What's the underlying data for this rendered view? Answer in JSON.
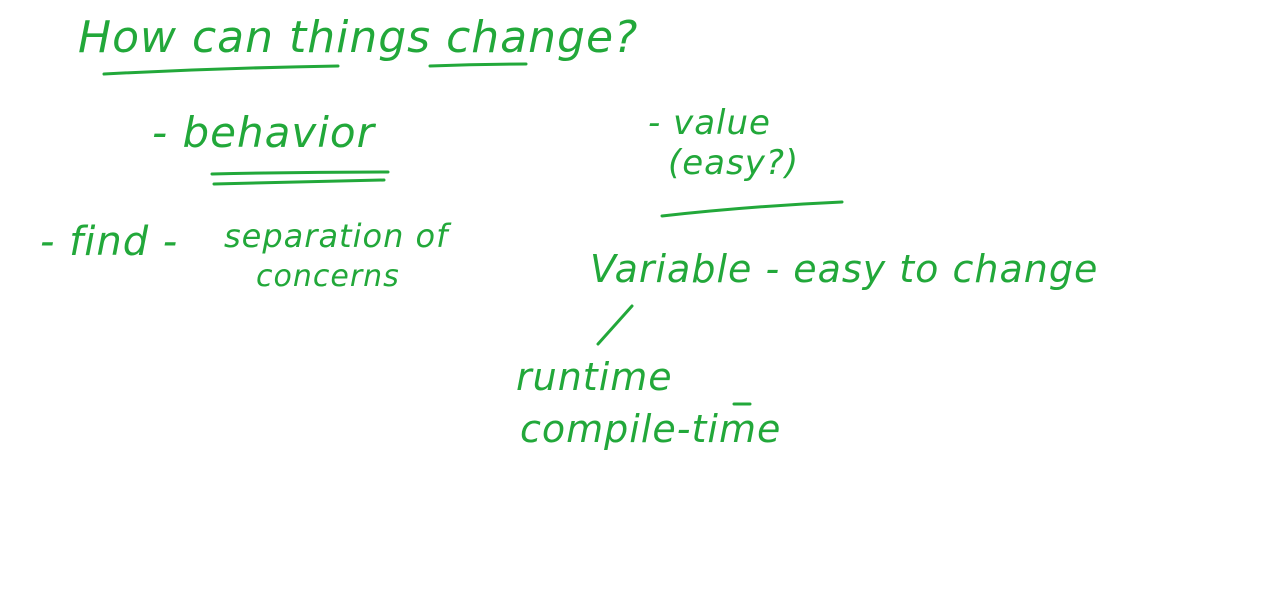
{
  "notes": {
    "title": "How can things change?",
    "behavior": "- behavior",
    "value": "- value",
    "value_note": "(easy?)",
    "find": "- find -",
    "separation": "separation of",
    "concerns": "concerns",
    "variable": "Variable - easy to change",
    "runtime": "runtime",
    "compile_time": "compile-time"
  },
  "colors": {
    "ink": "#22a83a",
    "background": "#ffffff"
  }
}
